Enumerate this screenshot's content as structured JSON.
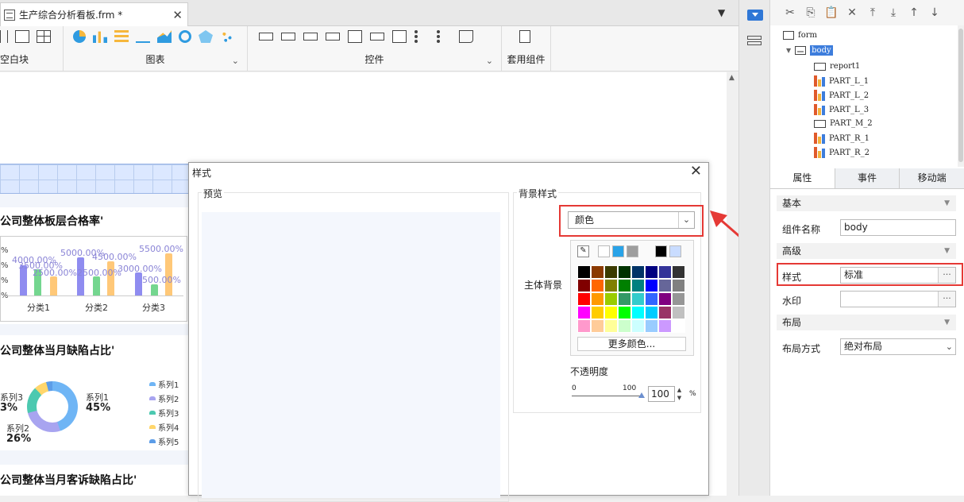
{
  "tab": {
    "title": "生产综合分析看板.frm *",
    "close": "✕"
  },
  "tab_menu": "▼",
  "toolbar": {
    "group_blank_label": "空白块",
    "group_chart_label": "图表",
    "group_control_label": "控件",
    "group_component_label": "套用组件",
    "chevron": "⌄"
  },
  "canvas": {
    "panel1_title": "公司整体板层合格率'",
    "panel2_title": "公司整体当月缺陷占比'",
    "panel3_title": "公司整体当月客诉缺陷占比'",
    "bar_chart": {
      "y_ticks": [
        "%",
        "%",
        "%",
        "%"
      ],
      "categories": [
        "分类1",
        "分类2",
        "分类3"
      ],
      "value_labels": [
        "4000.00%",
        "3500.00%",
        "2500.00%",
        "5000.00%",
        "2500.00%",
        "4500.00%",
        "3000.00%",
        "5500.00%",
        "500.00%"
      ]
    },
    "donut": {
      "labels": [
        "系列3",
        "系列1",
        "系列2"
      ],
      "percents": [
        "3%",
        "45%",
        "26%"
      ],
      "legend": [
        "系列1",
        "系列2",
        "系列3",
        "系列4",
        "系列5"
      ]
    }
  },
  "dialog": {
    "title": "样式",
    "close": "✕",
    "preview_label": "预览",
    "bg_style_label": "背景样式",
    "bg_select_value": "颜色",
    "main_bg_label": "主体背景",
    "more_colors": "更多颜色...",
    "opacity_label": "不透明度",
    "opacity_min": "0",
    "opacity_max": "100",
    "opacity_value": "100",
    "opacity_unit": "%"
  },
  "palette": {
    "top_colors": [
      "#ffffff",
      "#29a3e8",
      "#9e9e9e",
      "#000000",
      "#c9dcff"
    ],
    "grid_colors": [
      "#000000",
      "#8b3a00",
      "#3b3b00",
      "#003300",
      "#003366",
      "#000080",
      "#333399",
      "#333333",
      "#800000",
      "#ff6600",
      "#808000",
      "#008000",
      "#008080",
      "#0000ff",
      "#666699",
      "#808080",
      "#ff0000",
      "#ff9900",
      "#99cc00",
      "#339966",
      "#33cccc",
      "#3366ff",
      "#800080",
      "#969696",
      "#ff00ff",
      "#ffcc00",
      "#ffff00",
      "#00ff00",
      "#00ffff",
      "#00ccff",
      "#993366",
      "#c0c0c0",
      "#ff99cc",
      "#ffcc99",
      "#ffff99",
      "#ccffcc",
      "#ccffff",
      "#99ccff",
      "#cc99ff",
      "#ffffff"
    ]
  },
  "right": {
    "toolbar_icons": [
      "✂",
      "⎘",
      "📋",
      "✕",
      "⤒",
      "⤓",
      "↑",
      "↓"
    ],
    "tree": {
      "form": "form",
      "body": "body",
      "children": [
        "report1",
        "PART_L_1",
        "PART_L_2",
        "PART_L_3",
        "PART_M_2",
        "PART_R_1",
        "PART_R_2"
      ]
    },
    "tabs": [
      "属性",
      "事件",
      "移动端"
    ],
    "props": {
      "basic": "基本",
      "name_label": "组件名称",
      "name_value": "body",
      "advanced": "高级",
      "style_label": "样式",
      "style_value": "标准",
      "watermark_label": "水印",
      "watermark_value": "",
      "layout": "布局",
      "layout_mode_label": "布局方式",
      "layout_mode_value": "绝对布局",
      "dots": "···"
    }
  },
  "colors": {
    "accent": "#3d7ddc",
    "highlight_red": "#e53935",
    "bar_purple": "#8f8cf0",
    "bar_green": "#74d68f",
    "bar_orange": "#ffc878"
  }
}
